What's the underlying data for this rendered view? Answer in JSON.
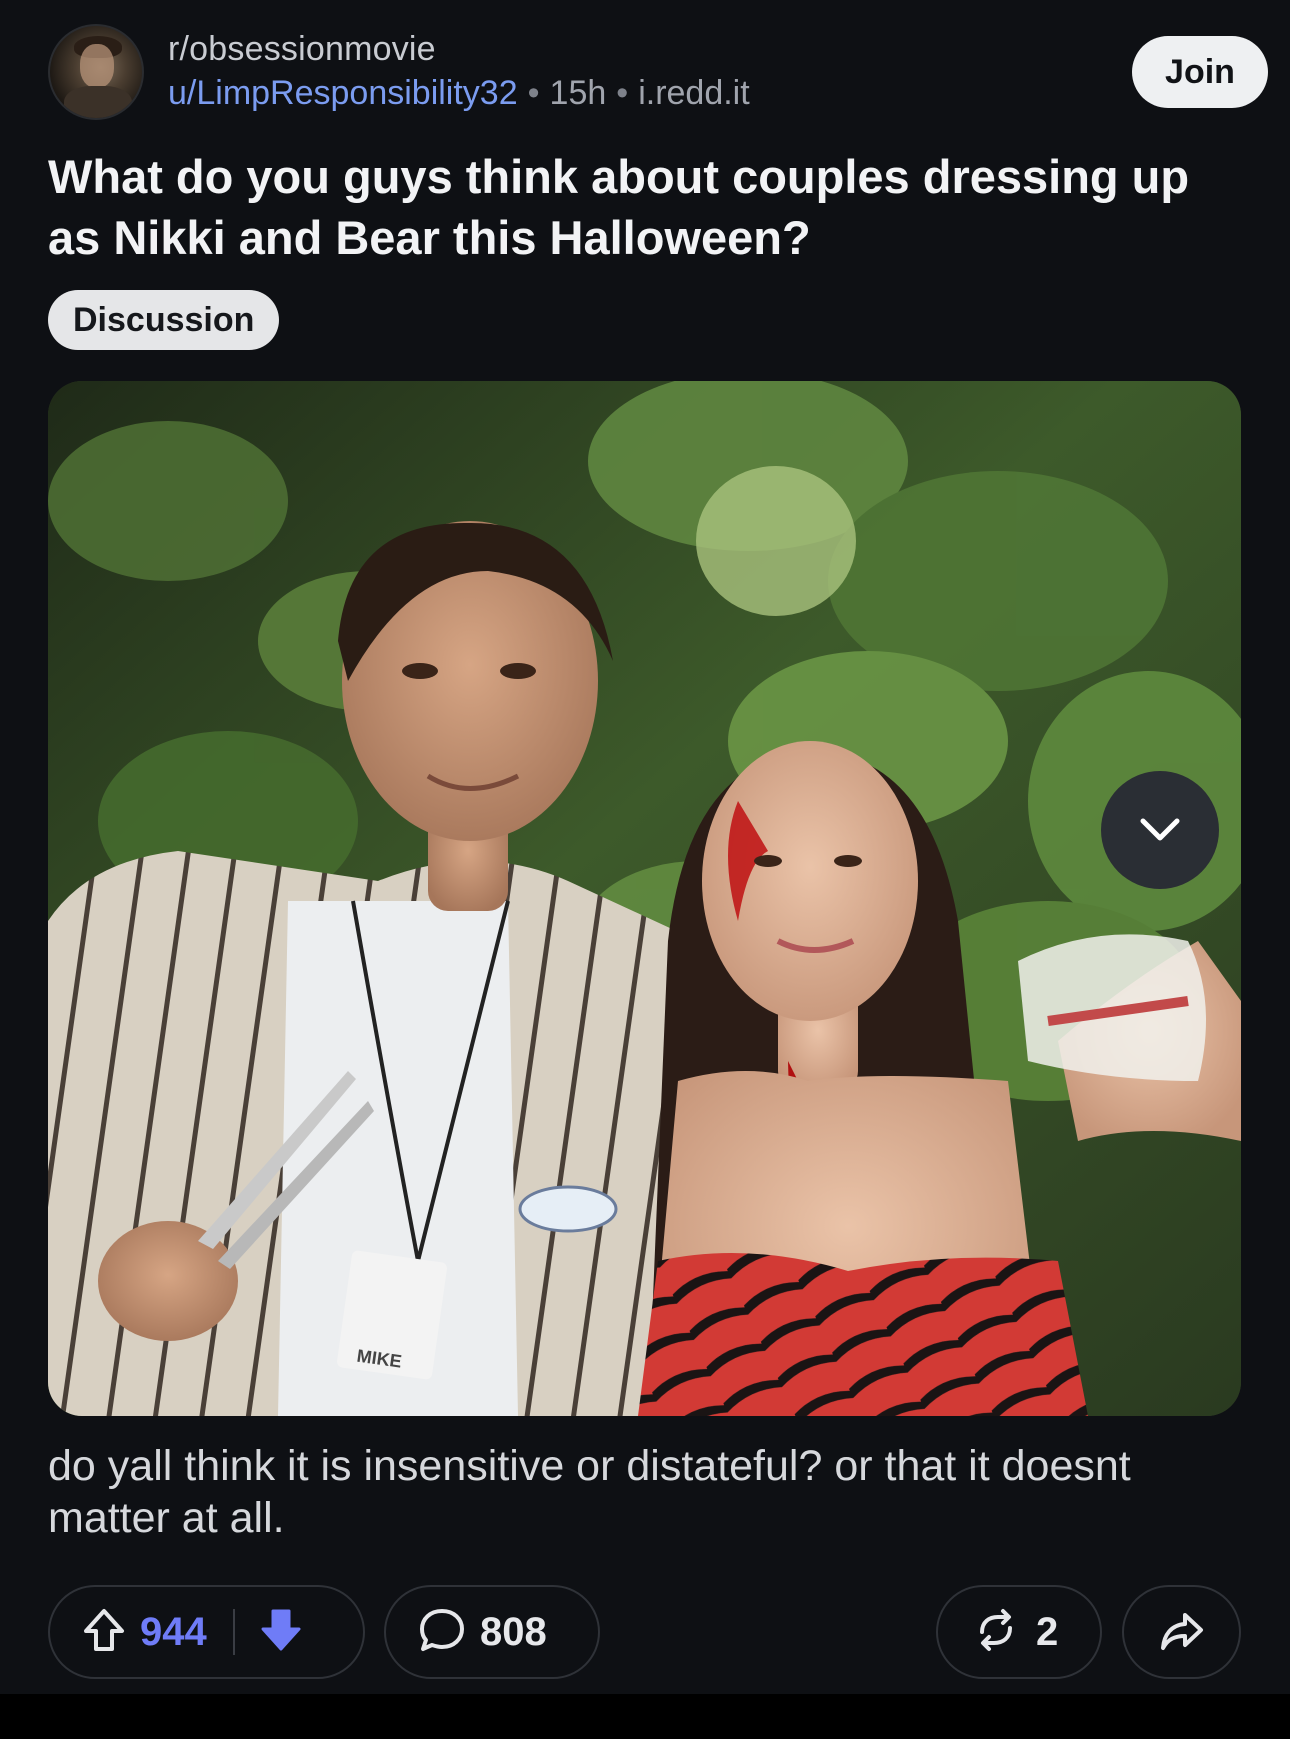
{
  "post": {
    "subreddit": "r/obsessionmovie",
    "author": "u/LimpResponsibility32",
    "age": "15h",
    "domain": "i.redd.it",
    "join_label": "Join",
    "title": "What do you guys think about couples dressing up as Nikki and Bear this Halloween?",
    "flair": "Discussion",
    "image": {
      "name_badge_text": "MIKE"
    },
    "body": "do yall think it is insensitive or distateful? or that it doesnt matter at all.",
    "separator": "•"
  },
  "actions": {
    "upvotes": "944",
    "comments": "808",
    "crossposts": "2"
  },
  "icons": {
    "upvote": "arrow-up-outline-icon",
    "downvote": "arrow-down-filled-icon",
    "comment": "speech-bubble-icon",
    "crosspost": "crosspost-arrows-icon",
    "share": "share-arrow-icon",
    "collapse": "chevron-down-icon"
  },
  "colors": {
    "background": "#0e1014",
    "username": "#7b9cf0",
    "vote_accent": "#6f7cf7",
    "join_bg": "#eef0f2"
  }
}
